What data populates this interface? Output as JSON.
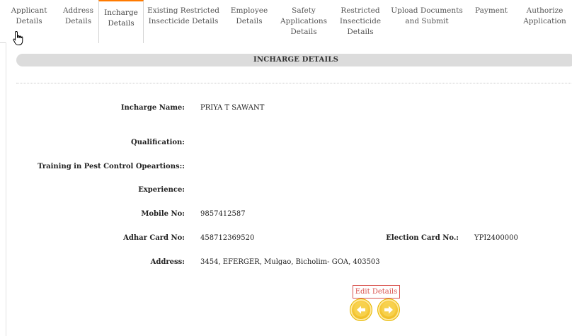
{
  "tabs": [
    {
      "label": "Applicant\nDetails",
      "active": false
    },
    {
      "label": "Address\nDetails",
      "active": false
    },
    {
      "label": "Incharge\nDetails",
      "active": true
    },
    {
      "label": "Existing Restricted\nInsecticide Details",
      "active": false
    },
    {
      "label": "Employee\nDetails",
      "active": false
    },
    {
      "label": "Safety\nApplications\nDetails",
      "active": false
    },
    {
      "label": "Restricted\nInsecticide\nDetails",
      "active": false
    },
    {
      "label": "Upload Documents\nand Submit",
      "active": false
    },
    {
      "label": "Payment",
      "active": false
    },
    {
      "label": "Authorize\nApplication",
      "active": false
    }
  ],
  "section": {
    "title": "INCHARGE DETAILS"
  },
  "fields": {
    "incharge_name": {
      "label": "Incharge Name:",
      "value": "PRIYA T SAWANT"
    },
    "qualification": {
      "label": "Qualification:",
      "value": ""
    },
    "training": {
      "label": "Training in Pest Control Opeartions::",
      "value": ""
    },
    "experience": {
      "label": "Experience:",
      "value": ""
    },
    "mobile": {
      "label": "Mobile No:",
      "value": "9857412587"
    },
    "adhar": {
      "label": "Adhar Card No:",
      "value": "458712369520"
    },
    "election": {
      "label": "Election Card No.:",
      "value": "YPI2400000"
    },
    "address": {
      "label": "Address:",
      "value": "3454, EFERGER, Mulgao, Bicholim- GOA, 403503"
    }
  },
  "buttons": {
    "edit_label": "Edit Details",
    "prev_icon": "arrow-left-icon",
    "next_icon": "arrow-right-icon"
  },
  "colors": {
    "active_tab_accent": "#ff7a00",
    "edit_button": "#d9534f",
    "nav_button": "#f4c430"
  }
}
